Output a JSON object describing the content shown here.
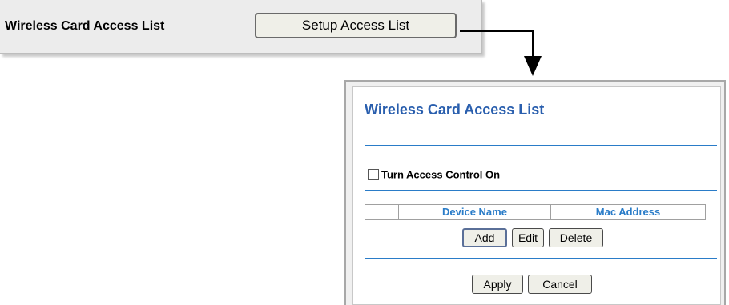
{
  "top_panel": {
    "label": "Wireless Card Access List",
    "button_label": "Setup Access List"
  },
  "dialog": {
    "title": "Wireless Card Access List",
    "access_control_label": "Turn Access Control On",
    "access_control_checked": false,
    "table_columns": [
      "",
      "Device Name",
      "Mac Address"
    ],
    "buttons": {
      "add": "Add",
      "edit": "Edit",
      "delete": "Delete",
      "apply": "Apply",
      "cancel": "Cancel"
    }
  },
  "colors": {
    "title_blue": "#2a5fae",
    "rule_blue": "#2a7cc8",
    "header_blue": "#2a7cc8"
  }
}
